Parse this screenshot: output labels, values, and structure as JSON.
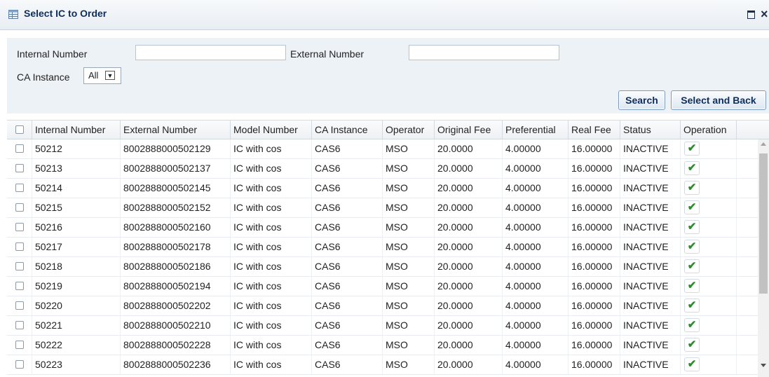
{
  "window": {
    "title": "Select IC to Order"
  },
  "form": {
    "internal_number_label": "Internal Number",
    "internal_number_value": "",
    "external_number_label": "External Number",
    "external_number_value": "",
    "ca_instance_label": "CA Instance",
    "ca_instance_selected": "All",
    "search_label": "Search",
    "select_back_label": "Select and Back"
  },
  "table": {
    "columns": [
      "Internal Number",
      "External Number",
      "Model Number",
      "CA Instance",
      "Operator",
      "Original Fee",
      "Preferential",
      "Real Fee",
      "Status",
      "Operation"
    ],
    "rows": [
      [
        "50212",
        "8002888000502129",
        "IC with cos",
        "CAS6",
        "MSO",
        "20.0000",
        "4.00000",
        "16.00000",
        "INACTIVE"
      ],
      [
        "50213",
        "8002888000502137",
        "IC with cos",
        "CAS6",
        "MSO",
        "20.0000",
        "4.00000",
        "16.00000",
        "INACTIVE"
      ],
      [
        "50214",
        "8002888000502145",
        "IC with cos",
        "CAS6",
        "MSO",
        "20.0000",
        "4.00000",
        "16.00000",
        "INACTIVE"
      ],
      [
        "50215",
        "8002888000502152",
        "IC with cos",
        "CAS6",
        "MSO",
        "20.0000",
        "4.00000",
        "16.00000",
        "INACTIVE"
      ],
      [
        "50216",
        "8002888000502160",
        "IC with cos",
        "CAS6",
        "MSO",
        "20.0000",
        "4.00000",
        "16.00000",
        "INACTIVE"
      ],
      [
        "50217",
        "8002888000502178",
        "IC with cos",
        "CAS6",
        "MSO",
        "20.0000",
        "4.00000",
        "16.00000",
        "INACTIVE"
      ],
      [
        "50218",
        "8002888000502186",
        "IC with cos",
        "CAS6",
        "MSO",
        "20.0000",
        "4.00000",
        "16.00000",
        "INACTIVE"
      ],
      [
        "50219",
        "8002888000502194",
        "IC with cos",
        "CAS6",
        "MSO",
        "20.0000",
        "4.00000",
        "16.00000",
        "INACTIVE"
      ],
      [
        "50220",
        "8002888000502202",
        "IC with cos",
        "CAS6",
        "MSO",
        "20.0000",
        "4.00000",
        "16.00000",
        "INACTIVE"
      ],
      [
        "50221",
        "8002888000502210",
        "IC with cos",
        "CAS6",
        "MSO",
        "20.0000",
        "4.00000",
        "16.00000",
        "INACTIVE"
      ],
      [
        "50222",
        "8002888000502228",
        "IC with cos",
        "CAS6",
        "MSO",
        "20.0000",
        "4.00000",
        "16.00000",
        "INACTIVE"
      ],
      [
        "50223",
        "8002888000502236",
        "IC with cos",
        "CAS6",
        "MSO",
        "20.0000",
        "4.00000",
        "16.00000",
        "INACTIVE"
      ]
    ],
    "operation_icon": "check-icon"
  },
  "colors": {
    "title_text": "#0e2d5e",
    "form_bg": "#edf2f7",
    "check_green": "#2e8b2e"
  }
}
